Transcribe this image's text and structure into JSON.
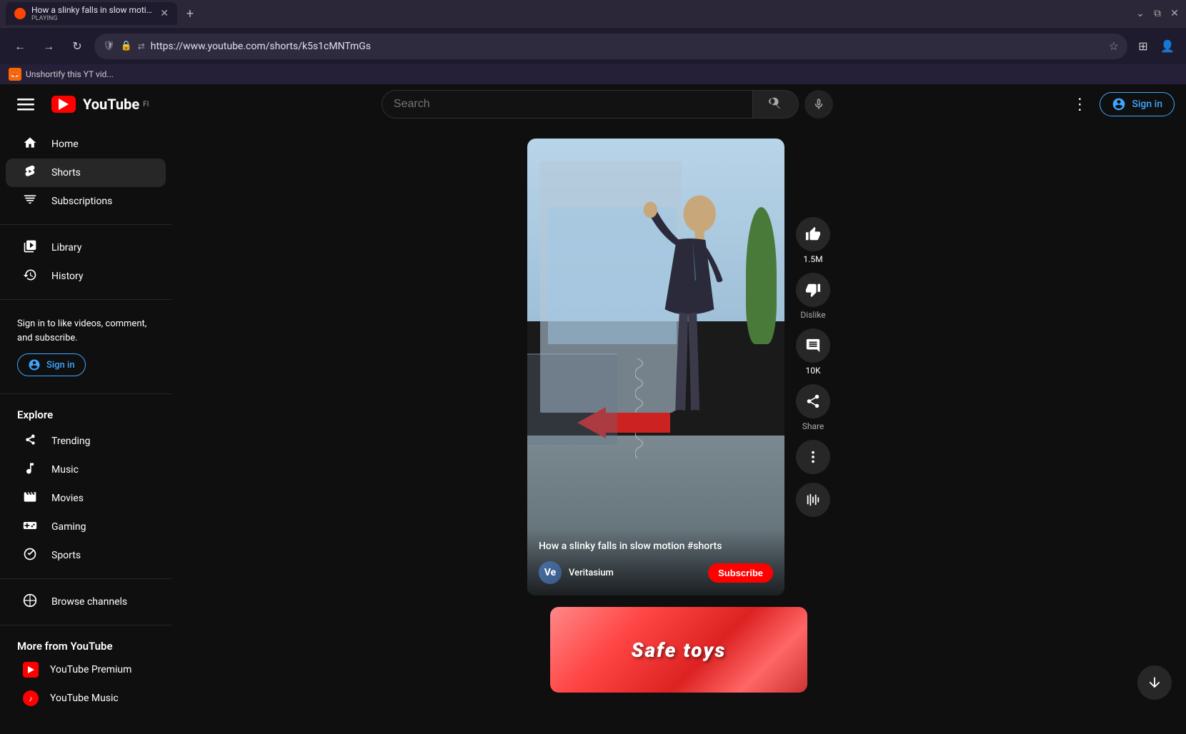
{
  "browser": {
    "tab_title": "How a slinky falls in slow motio...",
    "tab_playing": "PLAYING",
    "url": "https://www.youtube.com/shorts/k5s1cMNTmGs",
    "extension_text": "Unshortify this YT vid..."
  },
  "header": {
    "menu_label": "☰",
    "logo_text": "YouTube",
    "logo_country": "FI",
    "search_placeholder": "Search",
    "sign_in_label": "Sign in"
  },
  "sidebar": {
    "items": [
      {
        "id": "home",
        "label": "Home",
        "icon": "🏠"
      },
      {
        "id": "shorts",
        "label": "Shorts",
        "icon": "⚡"
      },
      {
        "id": "subscriptions",
        "label": "Subscriptions",
        "icon": "📺"
      }
    ],
    "library_items": [
      {
        "id": "library",
        "label": "Library",
        "icon": "📚"
      },
      {
        "id": "history",
        "label": "History",
        "icon": "🕐"
      }
    ],
    "signin_prompt": "Sign in to like videos, comment, and subscribe.",
    "signin_label": "Sign in",
    "explore_title": "Explore",
    "explore_items": [
      {
        "id": "trending",
        "label": "Trending",
        "icon": "🔥"
      },
      {
        "id": "music",
        "label": "Music",
        "icon": "🎵"
      },
      {
        "id": "movies",
        "label": "Movies",
        "icon": "🎬"
      },
      {
        "id": "gaming",
        "label": "Gaming",
        "icon": "🎮"
      },
      {
        "id": "sports",
        "label": "Sports",
        "icon": "🏆"
      }
    ],
    "browse_channels_label": "Browse channels",
    "more_from_title": "More from YouTube",
    "more_items": [
      {
        "id": "premium",
        "label": "YouTube Premium",
        "type": "yt"
      },
      {
        "id": "music",
        "label": "YouTube Music",
        "type": "ytmusic"
      }
    ]
  },
  "shorts": {
    "video_title": "How a slinky falls in slow motion #shorts",
    "channel_name": "Veritasium",
    "channel_initials": "Ve",
    "subscribe_label": "Subscribe",
    "like_count": "1.5M",
    "dislike_label": "Dislike",
    "comment_count": "10K",
    "share_label": "Share",
    "more_label": "•••"
  }
}
